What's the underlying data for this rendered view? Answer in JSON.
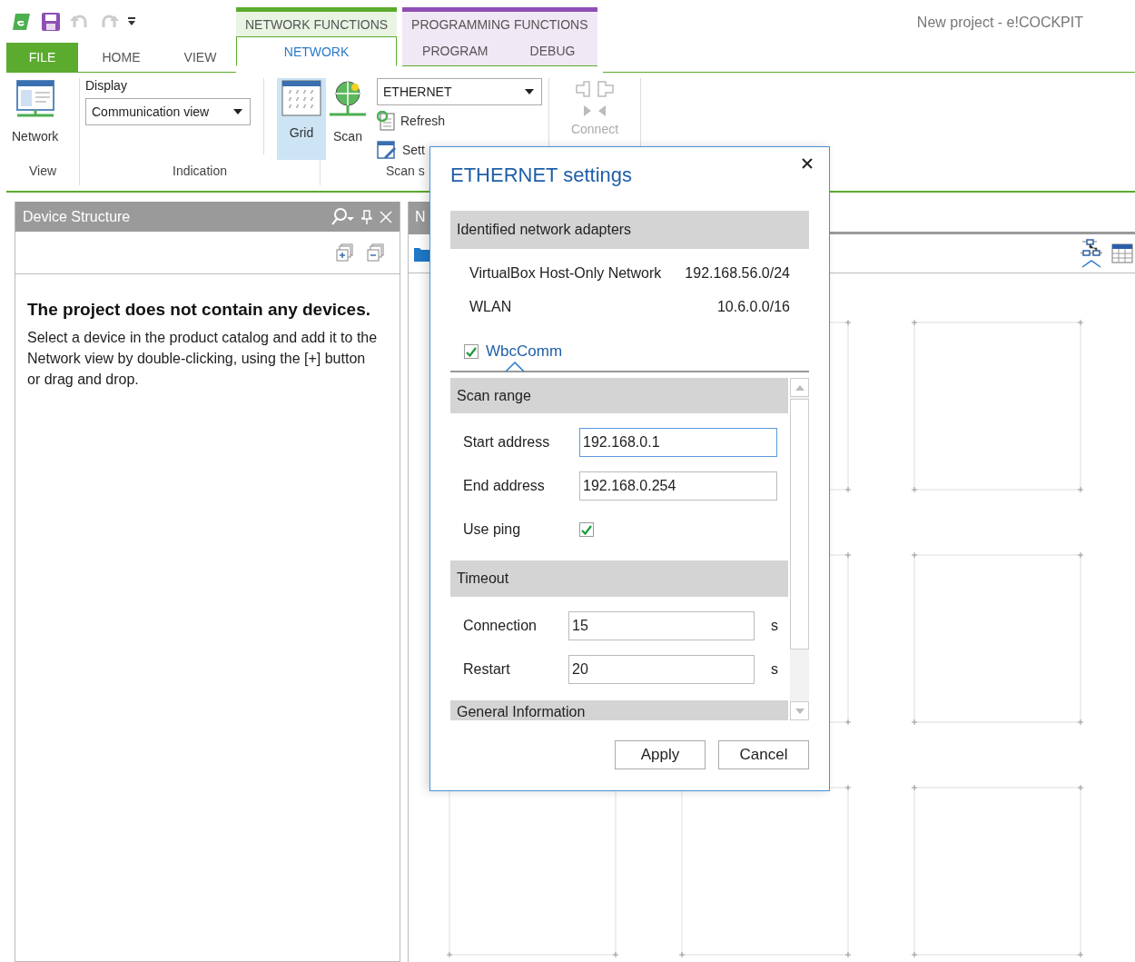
{
  "window": {
    "title": "New project - e!COCKPIT"
  },
  "tabs": [
    {
      "label": "FILE",
      "kind": "file",
      "selected": false
    },
    {
      "label": "HOME",
      "kind": "plain",
      "selected": false
    },
    {
      "label": "VIEW",
      "kind": "plain",
      "selected": false
    }
  ],
  "context_groups": [
    {
      "label": "NETWORK FUNCTIONS",
      "color": "#5aab2e",
      "tabs": [
        {
          "label": "NETWORK",
          "selected": true
        }
      ]
    },
    {
      "label": "PROGRAMMING FUNCTIONS",
      "color": "#8e4fb5",
      "tabs": [
        {
          "label": "PROGRAM",
          "selected": false
        },
        {
          "label": "DEBUG",
          "selected": false
        }
      ]
    }
  ],
  "ribbon": {
    "view_group": {
      "label": "View",
      "network_button": "Network"
    },
    "indication_group": {
      "label": "Indication",
      "display_label": "Display",
      "display_value": "Communication view",
      "grid_button": {
        "label": "Grid",
        "selected": true
      }
    },
    "scan_group": {
      "label": "Scan s",
      "scan_button": "Scan",
      "interface_value": "ETHERNET",
      "refresh_button": "Refresh",
      "settings_button": "Sett"
    },
    "connect_group": {
      "connect_button": {
        "label": "Connect",
        "disabled": true
      }
    }
  },
  "device_structure": {
    "title": "Device Structure",
    "empty_title": "The project does not contain any devices.",
    "empty_text": "Select a device in the product catalog and add it to the Network view by double-clicking, using the [+] button or drag and drop."
  },
  "network_panel": {
    "tab": "N"
  },
  "dialog": {
    "title": "ETHERNET settings",
    "adapters_heading": "Identified network adapters",
    "adapters": [
      {
        "name": "VirtualBox Host-Only Network",
        "address": "192.168.56.0/24"
      },
      {
        "name": "WLAN",
        "address": "10.6.0.0/16"
      }
    ],
    "plugin_tab": {
      "label": "WbcComm",
      "checked": true,
      "selected": true
    },
    "sections": [
      {
        "title": "Scan range",
        "fields": [
          {
            "kind": "text",
            "label": "Start address",
            "value": "192.168.0.1",
            "focused": true
          },
          {
            "kind": "text",
            "label": "End address",
            "value": "192.168.0.254",
            "focused": false
          },
          {
            "kind": "checkbox",
            "label": "Use ping",
            "checked": true
          }
        ]
      },
      {
        "title": "Timeout",
        "fields": [
          {
            "kind": "number",
            "label": "Connection",
            "value": "15",
            "unit": "s"
          },
          {
            "kind": "number",
            "label": "Restart",
            "value": "20",
            "unit": "s"
          }
        ]
      },
      {
        "title": "General Information"
      }
    ],
    "buttons": [
      "Apply",
      "Cancel"
    ]
  }
}
